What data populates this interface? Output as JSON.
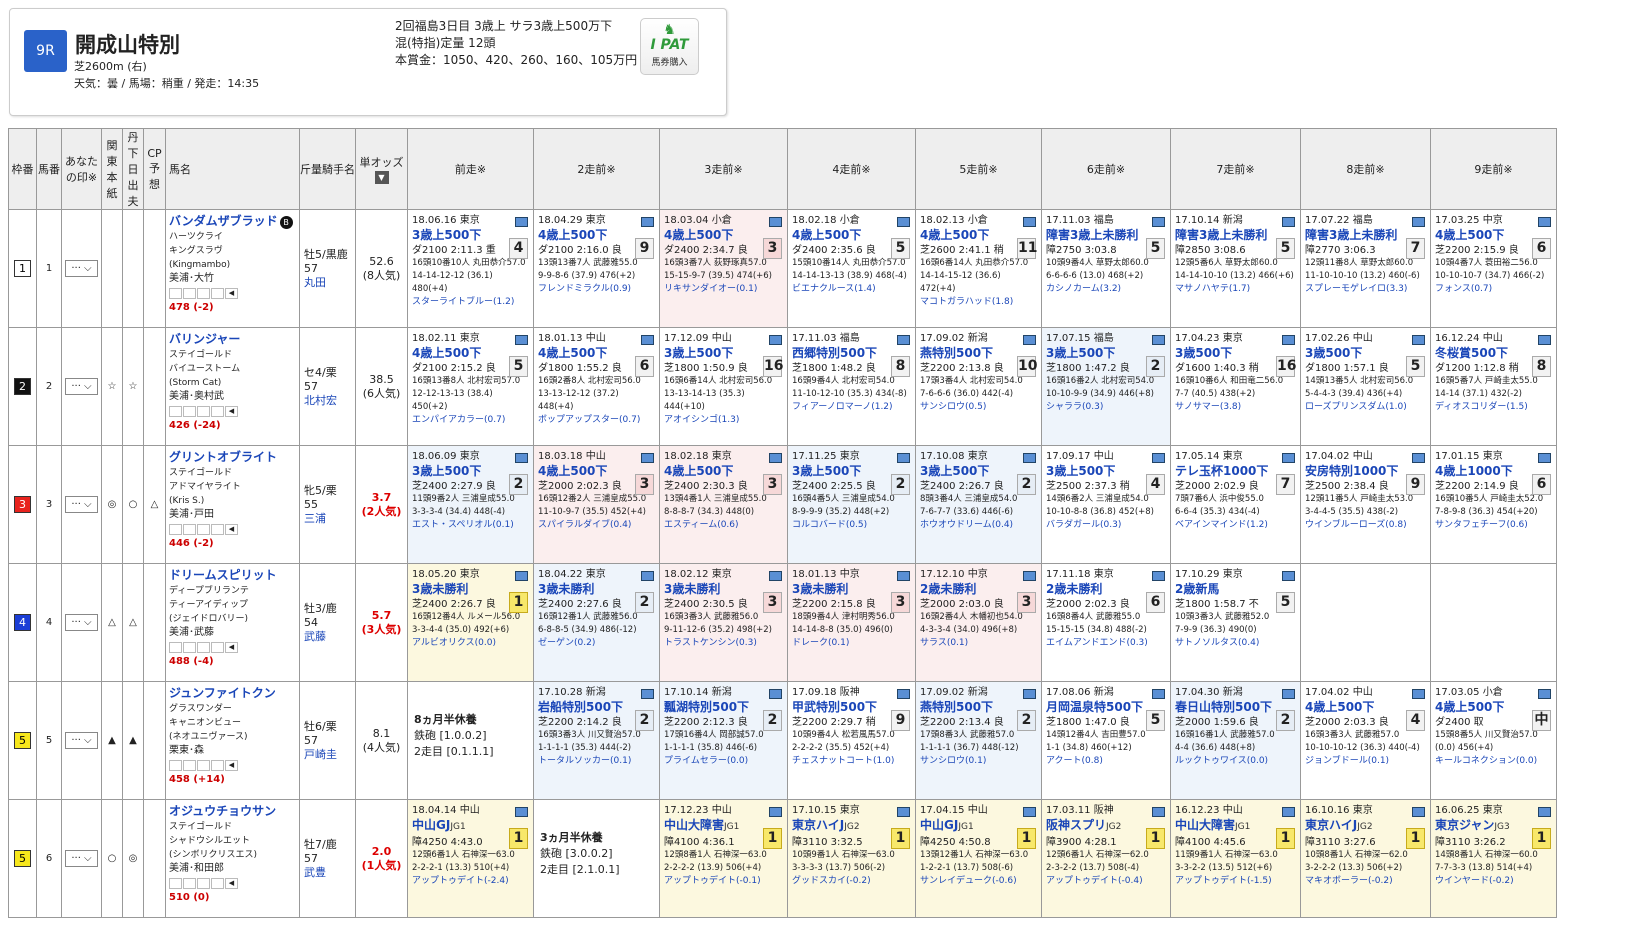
{
  "race": {
    "no": "9R",
    "name": "開成山特別",
    "course": "芝2600m (右)",
    "weather": "天気：曇 / 馬場：稍重 / 発走：14:35",
    "info1": "2回福島3日目 3歳上 サラ3歳上500万下",
    "info2": "混(特指)定量 12頭",
    "info3": "本賞金：1050、420、260、160、105万円"
  },
  "ipat": {
    "logo": "I PAT",
    "label": "馬券購入"
  },
  "headers": {
    "waku": "枠番",
    "uma": "馬番",
    "mark": "あなたの印※",
    "kanto": "関東本紙",
    "tan": "丹下日出夫",
    "cp": "CP予想",
    "name": "馬名",
    "weight": "斤量騎手名",
    "odds": "単オッズ",
    "prev": [
      "前走※",
      "2走前※",
      "3走前※",
      "4走前※",
      "5走前※",
      "6走前※",
      "7走前※",
      "8走前※",
      "9走前※"
    ]
  },
  "horses": [
    {
      "waku": "1",
      "wakucolor": "#ffffff",
      "wakutext": "#000",
      "uma": "1",
      "kanto": "",
      "tan": "",
      "cp": "",
      "name": "バンダムザブラッド",
      "blinker": "B",
      "sire": "ハーツクライ",
      "dam": "キングスラヴ",
      "damsire": "(Kingmambo)",
      "trainer": "美浦･大竹",
      "bw": "478 (-2)",
      "sex": "牡5/黒鹿",
      "kg": "57",
      "jockey": "丸田",
      "odds": "52.6",
      "pop": "(8人気)",
      "hot": false,
      "runs": [
        {
          "p": 1,
          "date": "18.06.16 東京",
          "race": "3歳上500下",
          "pos": "4",
          "dist": "ダ2100 2:11.3 重",
          "line1": "16頭10番10人 丸田恭介57.0",
          "line2": "14-14-12-12 (36.1) 480(+4)",
          "winner": "スターライトブルー(1.2)",
          "cls": ""
        },
        {
          "date": "18.04.29 東京",
          "race": "4歳上500下",
          "pos": "9",
          "dist": "ダ2100 2:16.0 良",
          "line1": "13頭13番7人 武藤雅55.0",
          "line2": "9-9-8-6 (37.9) 476(+2)",
          "winner": "フレンドミラクル(0.9)",
          "cls": ""
        },
        {
          "date": "18.03.04 小倉",
          "race": "4歳上500下",
          "pos": "3",
          "dist": "ダ2400 2:34.7 良",
          "line1": "16頭3番7人 荻野琢真57.0",
          "line2": "15-15-9-7 (39.5) 474(+6)",
          "winner": "リキサンダイオー(0.1)",
          "cls": "p3"
        },
        {
          "date": "18.02.18 小倉",
          "race": "4歳上500下",
          "pos": "5",
          "dist": "ダ2400 2:35.6 良",
          "line1": "15頭10番14人 丸田恭介57.0",
          "line2": "14-14-13-13 (38.9) 468(-4)",
          "winner": "ビエナクルース(1.4)",
          "cls": ""
        },
        {
          "date": "18.02.13 小倉",
          "race": "4歳上500下",
          "pos": "11",
          "dist": "芝2600 2:41.1 稍",
          "line1": "16頭6番14人 丸田恭介57.0",
          "line2": "14-14-15-12 (36.6) 472(+4)",
          "winner": "マコトガラハッド(1.8)",
          "cls": ""
        },
        {
          "date": "17.11.03 福島",
          "race": "障害3歳上未勝利",
          "pos": "5",
          "dist": "障2750 3:03.8",
          "line1": "10頭9番4人 草野太郎60.0",
          "line2": "6-6-6-6 (13.0) 468(+2)",
          "winner": "カシノカーム(3.2)",
          "cls": ""
        },
        {
          "date": "17.10.14 新潟",
          "race": "障害3歳上未勝利",
          "pos": "5",
          "dist": "障2850 3:08.6",
          "line1": "12頭5番6人 草野太郎60.0",
          "line2": "14-14-10-10 (13.2) 466(+6)",
          "winner": "マサノハヤテ(1.7)",
          "cls": ""
        },
        {
          "date": "17.07.22 福島",
          "race": "障害3歳上未勝利",
          "pos": "7",
          "dist": "障2770 3:06.3",
          "line1": "12頭11番8人 草野太郎60.0",
          "line2": "11-10-10-10 (13.2) 460(-6)",
          "winner": "スプレーモゲレイロ(3.3)",
          "cls": ""
        },
        {
          "date": "17.03.25 中京",
          "race": "4歳上500下",
          "pos": "6",
          "dist": "芝2200 2:15.9 良",
          "line1": "10頭4番7人 蓑田裕二56.0",
          "line2": "10-10-10-7 (34.7) 466(-2)",
          "winner": "フォンス(0.7)",
          "cls": ""
        }
      ]
    },
    {
      "waku": "2",
      "wakucolor": "#111111",
      "wakutext": "#fff",
      "uma": "2",
      "kanto": "☆",
      "tan": "☆",
      "cp": "",
      "name": "バリンジャー",
      "blinker": "",
      "sire": "ステイゴールド",
      "dam": "バイユーストーム",
      "damsire": "(Storm Cat)",
      "trainer": "美浦･奥村武",
      "bw": "426 (-24)",
      "sex": "セ4/栗",
      "kg": "57",
      "jockey": "北村宏",
      "odds": "38.5",
      "pop": "(6人気)",
      "hot": false,
      "runs": [
        {
          "date": "18.02.11 東京",
          "race": "4歳上500下",
          "pos": "5",
          "dist": "ダ2100 2:15.2 良",
          "line1": "16頭13番8人 北村宏司57.0",
          "line2": "12-12-13-13 (38.4) 450(+2)",
          "winner": "エンパイアカラー(0.7)",
          "cls": ""
        },
        {
          "date": "18.01.13 中山",
          "race": "4歳上500下",
          "pos": "6",
          "dist": "ダ1800 1:55.2 良",
          "line1": "16頭2番8人 北村宏司56.0",
          "line2": "13-13-12-12 (37.2) 448(+4)",
          "winner": "ボップアップスター(0.7)",
          "cls": ""
        },
        {
          "date": "17.12.09 中山",
          "race": "3歳上500下",
          "pos": "16",
          "dist": "芝1800 1:50.9 良",
          "line1": "16頭6番14人 北村宏司56.0",
          "line2": "13-13-14-13 (35.3) 444(+10)",
          "winner": "アオイシンゴ(1.3)",
          "cls": ""
        },
        {
          "date": "17.11.03 福島",
          "race": "西郷特別500下",
          "pos": "8",
          "dist": "芝1800 1:48.2 良",
          "line1": "16頭9番4人 北村宏司54.0",
          "line2": "11-10-12-10 (35.3) 434(-8)",
          "winner": "フィアーノロマーノ(1.2)",
          "cls": ""
        },
        {
          "date": "17.09.02 新潟",
          "race": "燕特別500下",
          "pos": "10",
          "dist": "芝2200 2:13.8 良",
          "line1": "17頭3番4人 北村宏司54.0",
          "line2": "7-6-6-6 (36.0) 442(-4)",
          "winner": "サンシロウ(0.5)",
          "cls": ""
        },
        {
          "date": "17.07.15 福島",
          "race": "3歳上500下",
          "pos": "2",
          "dist": "芝1800 1:47.2 良",
          "line1": "16頭16番2人 北村宏司54.0",
          "line2": "10-10-9-9 (34.9) 446(+8)",
          "winner": "シャララ(0.3)",
          "cls": "p2"
        },
        {
          "date": "17.04.23 東京",
          "race": "3歳500下",
          "pos": "16",
          "dist": "ダ1600 1:40.3 稍",
          "line1": "16頭10番6人 和田竜二56.0",
          "line2": "7-7 (40.5) 438(+2)",
          "winner": "サノサマー(3.8)",
          "cls": ""
        },
        {
          "date": "17.02.26 中山",
          "race": "3歳500下",
          "pos": "5",
          "dist": "ダ1800 1:57.1 良",
          "line1": "14頭13番5人 北村宏司56.0",
          "line2": "5-4-4-3 (39.4) 436(+4)",
          "winner": "ローズプリンスダム(1.0)",
          "cls": ""
        },
        {
          "date": "16.12.24 中山",
          "race": "冬桜賞500下",
          "pos": "8",
          "dist": "ダ1200 1:12.8 稍",
          "line1": "16頭5番7人 戸崎圭太55.0",
          "line2": "14-14 (37.1) 432(-2)",
          "winner": "ディオスコリダー(1.5)",
          "cls": ""
        }
      ]
    },
    {
      "waku": "3",
      "wakucolor": "#e8231e",
      "wakutext": "#fff",
      "uma": "3",
      "kanto": "◎",
      "tan": "○",
      "cp": "△",
      "name": "グリントオブライト",
      "blinker": "",
      "sire": "ステイゴールド",
      "dam": "アドマイヤライト",
      "damsire": "(Kris S.)",
      "trainer": "美浦･戸田",
      "bw": "446 (-2)",
      "sex": "牝5/栗",
      "kg": "55",
      "jockey": "三浦",
      "odds": "3.7",
      "pop": "(2人気)",
      "hot": true,
      "runs": [
        {
          "date": "18.06.09 東京",
          "race": "3歳上500下",
          "pos": "2",
          "dist": "芝2400 2:27.9 良",
          "line1": "11頭9番2人 三浦皇成55.0",
          "line2": "3-3-3-4 (34.4) 448(-4)",
          "winner": "エスト・スペリオル(0.1)",
          "cls": "p2"
        },
        {
          "date": "18.03.18 中山",
          "race": "4歳上500下",
          "pos": "3",
          "dist": "芝2000 2:02.3 良",
          "line1": "16頭12番2人 三浦皇成55.0",
          "line2": "11-10-9-7 (35.5) 452(+4)",
          "winner": "スパイラルダイブ(0.4)",
          "cls": "p3"
        },
        {
          "date": "18.02.18 東京",
          "race": "4歳上500下",
          "pos": "3",
          "dist": "芝2400 2:30.3 良",
          "line1": "13頭4番1人 三浦皇成55.0",
          "line2": "8-8-8-7 (34.3) 448(0)",
          "winner": "エスティーム(0.6)",
          "cls": "p3"
        },
        {
          "date": "17.11.25 東京",
          "race": "3歳上500下",
          "pos": "2",
          "dist": "芝2400 2:25.5 良",
          "line1": "16頭4番5人 三浦皇成54.0",
          "line2": "8-9-9-9 (35.2) 448(+2)",
          "winner": "コルコバード(0.5)",
          "cls": "p2"
        },
        {
          "date": "17.10.08 東京",
          "race": "3歳上500下",
          "pos": "2",
          "dist": "芝2400 2:26.7 良",
          "line1": "8頭3番4人 三浦皇成54.0",
          "line2": "7-6-7-7 (33.6) 446(-6)",
          "winner": "ホウオウドリーム(0.4)",
          "cls": "p2"
        },
        {
          "date": "17.09.17 中山",
          "race": "3歳上500下",
          "pos": "4",
          "dist": "芝2500 2:37.3 稍",
          "line1": "14頭6番2人 三浦皇成54.0",
          "line2": "10-10-8-8 (36.8) 452(+8)",
          "winner": "バラダガール(0.3)",
          "cls": ""
        },
        {
          "date": "17.05.14 東京",
          "race": "テレ玉杯1000下",
          "pos": "7",
          "dist": "芝2000 2:02.9 良",
          "line1": "7頭7番6人 浜中俊55.0",
          "line2": "6-6-4 (35.3) 434(-4)",
          "winner": "ベアインマインド(1.2)",
          "cls": ""
        },
        {
          "date": "17.04.02 中山",
          "race": "安房特別1000下",
          "pos": "9",
          "dist": "芝2500 2:38.4 良",
          "line1": "12頭11番5人 戸崎圭太53.0",
          "line2": "3-4-4-5 (35.5) 438(-2)",
          "winner": "ウインブルーローズ(0.8)",
          "cls": ""
        },
        {
          "date": "17.01.15 東京",
          "race": "4歳上1000下",
          "pos": "6",
          "dist": "芝2200 2:14.9 良",
          "line1": "16頭10番5人 戸崎圭太52.0",
          "line2": "7-8-9-8 (36.3) 454(+20)",
          "winner": "サンタフェチーフ(0.6)",
          "cls": ""
        }
      ]
    },
    {
      "waku": "4",
      "wakucolor": "#1b3ed6",
      "wakutext": "#fff",
      "uma": "4",
      "kanto": "△",
      "tan": "△",
      "cp": "",
      "name": "ドリームスピリット",
      "blinker": "",
      "sire": "ディープブリランテ",
      "dam": "ティーアイディップ",
      "damsire": "(ジェイドロバリー)",
      "trainer": "美浦･武藤",
      "bw": "488 (-4)",
      "sex": "牡3/鹿",
      "kg": "54",
      "jockey": "武藤",
      "odds": "5.7",
      "pop": "(3人気)",
      "hot": true,
      "runs": [
        {
          "date": "18.05.20 東京",
          "race": "3歳未勝利",
          "pos": "1",
          "dist": "芝2400 2:26.7 良",
          "line1": "16頭12番4人 ルメール56.0",
          "line2": "3-3-4-4 (35.0) 492(+6)",
          "winner": "アルビオリクス(0.0)",
          "cls": "p1"
        },
        {
          "date": "18.04.22 東京",
          "race": "3歳未勝利",
          "pos": "2",
          "dist": "芝2400 2:27.6 良",
          "line1": "16頭12番1人 武藤雅56.0",
          "line2": "6-8-8-5 (34.9) 486(-12)",
          "winner": "ゼーゲン(0.2)",
          "cls": "p2"
        },
        {
          "date": "18.02.12 東京",
          "race": "3歳未勝利",
          "pos": "3",
          "dist": "芝2400 2:30.5 良",
          "line1": "16頭3番3人 武藤雅56.0",
          "line2": "9-11-12-6 (35.2) 498(+2)",
          "winner": "トラストケンシン(0.3)",
          "cls": "p3"
        },
        {
          "date": "18.01.13 中京",
          "race": "3歳未勝利",
          "pos": "3",
          "dist": "芝2200 2:15.8 良",
          "line1": "18頭9番4人 津村明秀56.0",
          "line2": "14-14-8-8 (35.0) 496(0)",
          "winner": "ドレーク(0.1)",
          "cls": "p3"
        },
        {
          "date": "17.12.10 中京",
          "race": "2歳未勝利",
          "pos": "3",
          "dist": "芝2000 2:03.0 良",
          "line1": "16頭2番4人 木幡初也54.0",
          "line2": "4-3-3-4 (34.0) 496(+8)",
          "winner": "サラス(0.1)",
          "cls": "p3"
        },
        {
          "date": "17.11.18 東京",
          "race": "2歳未勝利",
          "pos": "6",
          "dist": "芝2000 2:02.3 良",
          "line1": "16頭8番4人 武藤雅55.0",
          "line2": "15-15-15 (34.8) 488(-2)",
          "winner": "エイムアンドエンド(0.3)",
          "cls": ""
        },
        {
          "date": "17.10.29 東京",
          "race": "2歳新馬",
          "pos": "5",
          "dist": "芝1800 1:58.7 不",
          "line1": "10頭3番3人 武藤雅52.0",
          "line2": "7-9-9 (36.3) 490(0)",
          "winner": "サトノソルタス(0.4)",
          "cls": ""
        },
        {
          "date": "",
          "race": "",
          "pos": "",
          "dist": "",
          "line1": "",
          "line2": "",
          "winner": "",
          "cls": "empty"
        },
        {
          "date": "",
          "race": "",
          "pos": "",
          "dist": "",
          "line1": "",
          "line2": "",
          "winner": "",
          "cls": "empty"
        }
      ]
    },
    {
      "waku": "5",
      "wakucolor": "#f7e71c",
      "wakutext": "#000",
      "uma": "5",
      "kanto": "▲",
      "tan": "▲",
      "cp": "",
      "name": "ジュンファイトクン",
      "blinker": "",
      "sire": "グラスワンダー",
      "dam": "キャニオンビュー",
      "damsire": "(ネオユニヴァース)",
      "trainer": "栗東･森",
      "bw": "458 (+14)",
      "sex": "牡6/栗",
      "kg": "57",
      "jockey": "戸崎圭",
      "odds": "8.1",
      "pop": "(4人気)",
      "hot": false,
      "rest": {
        "t": "8ヵ月半休養",
        "a": "鉄砲 [1.0.0.2]",
        "b": "2走目 [0.1.1.1]"
      },
      "runs": [
        {
          "date": "17.10.28 新潟",
          "race": "岩船特別500下",
          "pos": "2",
          "dist": "芝2200 2:14.2 良",
          "line1": "16頭3番3人 川又賢治57.0",
          "line2": "1-1-1-1 (35.3) 444(-2)",
          "winner": "トータルソッカー(0.1)",
          "cls": "p2"
        },
        {
          "date": "17.10.14 新潟",
          "race": "瓢湖特別500下",
          "pos": "2",
          "dist": "芝2200 2:12.3 良",
          "line1": "17頭16番4人 岡部誠57.0",
          "line2": "1-1-1-1 (35.8) 446(-6)",
          "winner": "プライムセラー(0.0)",
          "cls": "p2"
        },
        {
          "date": "17.09.18 阪神",
          "race": "甲武特別500下",
          "pos": "9",
          "dist": "芝2200 2:29.7 稍",
          "line1": "10頭9番4人 松若風馬57.0",
          "line2": "2-2-2-2 (35.5) 452(+4)",
          "winner": "チェスナットコート(1.0)",
          "cls": ""
        },
        {
          "date": "17.09.02 新潟",
          "race": "燕特別500下",
          "pos": "2",
          "dist": "芝2200 2:13.4 良",
          "line1": "17頭8番3人 武藤雅57.0",
          "line2": "1-1-1-1 (36.7) 448(-12)",
          "winner": "サンシロウ(0.1)",
          "cls": "p2"
        },
        {
          "date": "17.08.06 新潟",
          "race": "月岡温泉特500下",
          "pos": "5",
          "dist": "芝1800 1:47.0 良",
          "line1": "14頭12番4人 吉田豊57.0",
          "line2": "1-1 (34.8) 460(+12)",
          "winner": "アクート(0.8)",
          "cls": ""
        },
        {
          "date": "17.04.30 新潟",
          "race": "春日山特別500下",
          "pos": "2",
          "dist": "芝2000 1:59.6 良",
          "line1": "16頭16番1人 武藤雅57.0",
          "line2": "4-4 (36.6) 448(+8)",
          "winner": "ルックトゥワイス(0.0)",
          "cls": "p2"
        },
        {
          "date": "17.04.02 中山",
          "race": "4歳上500下",
          "pos": "4",
          "dist": "芝2000 2:03.3 良",
          "line1": "16頭3番3人 武藤雅57.0",
          "line2": "10-10-10-12 (36.3) 440(-4)",
          "winner": "ジョンブドール(0.1)",
          "cls": ""
        },
        {
          "date": "17.03.05 小倉",
          "race": "4歳上500下",
          "pos": "中",
          "dist": "ダ2400 取",
          "line1": "15頭8番5人 川又賢治57.0",
          "line2": "(0.0) 456(+4)",
          "winner": "キールコネクション(0.0)",
          "cls": ""
        }
      ]
    },
    {
      "waku": "5",
      "wakucolor": "#f7e71c",
      "wakutext": "#000",
      "uma": "6",
      "kanto": "○",
      "tan": "◎",
      "cp": "",
      "name": "オジュウチョウサン",
      "blinker": "",
      "sire": "ステイゴールド",
      "dam": "シャドウシルエット",
      "damsire": "(シンボリクリスエス)",
      "trainer": "美浦･和田郎",
      "bw": "510 (0)",
      "sex": "牡7/鹿",
      "kg": "57",
      "jockey": "武豊",
      "odds": "2.0",
      "pop": "(1人気)",
      "hot": true,
      "runs": [
        {
          "date": "18.04.14 中山",
          "race": "中山GJ",
          "grade": "JG1",
          "pos": "1",
          "dist": "障4250 4:43.0",
          "line1": "12頭6番1人 石神深一63.0",
          "line2": "2-2-2-1 (13.3) 510(+4)",
          "winner": "アップトゥデイト(-2.4)",
          "cls": "p1"
        },
        {
          "isrest": true,
          "t": "3ヵ月半休養",
          "a": "鉄砲 [3.0.0.2]",
          "b": "2走目 [2.1.0.1]"
        },
        {
          "date": "17.12.23 中山",
          "race": "中山大障害",
          "grade": "JG1",
          "pos": "1",
          "dist": "障4100 4:36.1",
          "line1": "12頭8番1人 石神深一63.0",
          "line2": "2-2-2-2 (13.9) 506(+4)",
          "winner": "アップトゥデイト(-0.1)",
          "cls": "p1"
        },
        {
          "date": "17.10.15 東京",
          "race": "東京ハイJ",
          "grade": "JG2",
          "pos": "1",
          "dist": "障3110 3:32.5",
          "line1": "10頭9番1人 石神深一63.0",
          "line2": "3-3-3-3 (13.7) 506(-2)",
          "winner": "グッドスカイ(-0.2)",
          "cls": "p1"
        },
        {
          "date": "17.04.15 中山",
          "race": "中山GJ",
          "grade": "JG1",
          "pos": "1",
          "dist": "障4250 4:50.8",
          "line1": "13頭12番1人 石神深一63.0",
          "line2": "1-2-2-1 (13.7) 508(-6)",
          "winner": "サンレイデューク(-0.6)",
          "cls": "p1"
        },
        {
          "date": "17.03.11 阪神",
          "race": "阪神スプリ",
          "grade": "JG2",
          "pos": "1",
          "dist": "障3900 4:28.1",
          "line1": "12頭6番1人 石神深一62.0",
          "line2": "2-3-2-2 (13.7) 508(-4)",
          "winner": "アップトゥデイト(-0.4)",
          "cls": "p1"
        },
        {
          "date": "16.12.23 中山",
          "race": "中山大障害",
          "grade": "JG1",
          "pos": "1",
          "dist": "障4100 4:45.6",
          "line1": "11頭9番1人 石神深一63.0",
          "line2": "3-3-2-2 (13.5) 512(+6)",
          "winner": "アップトゥデイト(-1.5)",
          "cls": "p1"
        },
        {
          "date": "16.10.16 東京",
          "race": "東京ハイJ",
          "grade": "JG2",
          "pos": "1",
          "dist": "障3110 3:27.6",
          "line1": "10頭8番1人 石神深一62.0",
          "line2": "3-2-2-2 (13.3) 506(+2)",
          "winner": "マキオボーラー(-0.2)",
          "cls": "p1"
        },
        {
          "date": "16.06.25 東京",
          "race": "東京ジャン",
          "grade": "JG3",
          "pos": "1",
          "dist": "障3110 3:26.2",
          "line1": "14頭8番1人 石神深一60.0",
          "line2": "7-7-3-3 (13.8) 514(+4)",
          "winner": "ウインヤード(-0.2)",
          "cls": "p1"
        }
      ]
    }
  ]
}
